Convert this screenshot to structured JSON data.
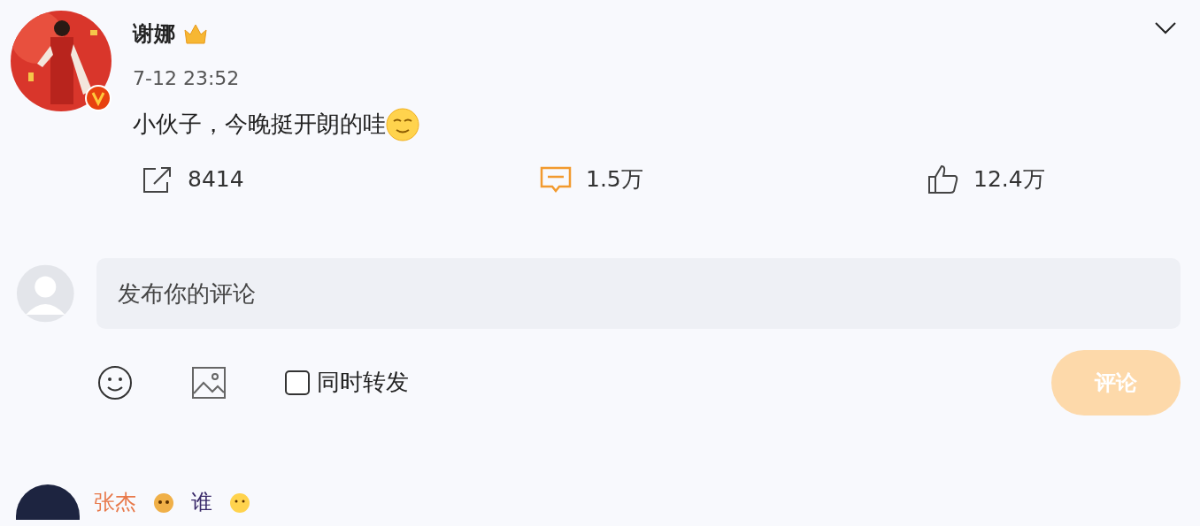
{
  "post": {
    "author": "谢娜",
    "verified": true,
    "time": "7-12 23:52",
    "text": "小伙子，今晚挺开朗的哇",
    "actions": [
      {
        "kind": "repost",
        "count": "8414",
        "expanded": false
      },
      {
        "kind": "comment",
        "count": "1.5万",
        "expanded": true
      },
      {
        "kind": "like",
        "count": "12.4万",
        "expanded": false
      }
    ]
  },
  "composer": {
    "placeholder": "发布你的评论",
    "repost_also": {
      "label": "同时转发",
      "checked": false
    },
    "submit": {
      "label": "评论",
      "disabled": true
    }
  },
  "comments": [
    {
      "author": "张杰",
      "text": "谁"
    }
  ]
}
